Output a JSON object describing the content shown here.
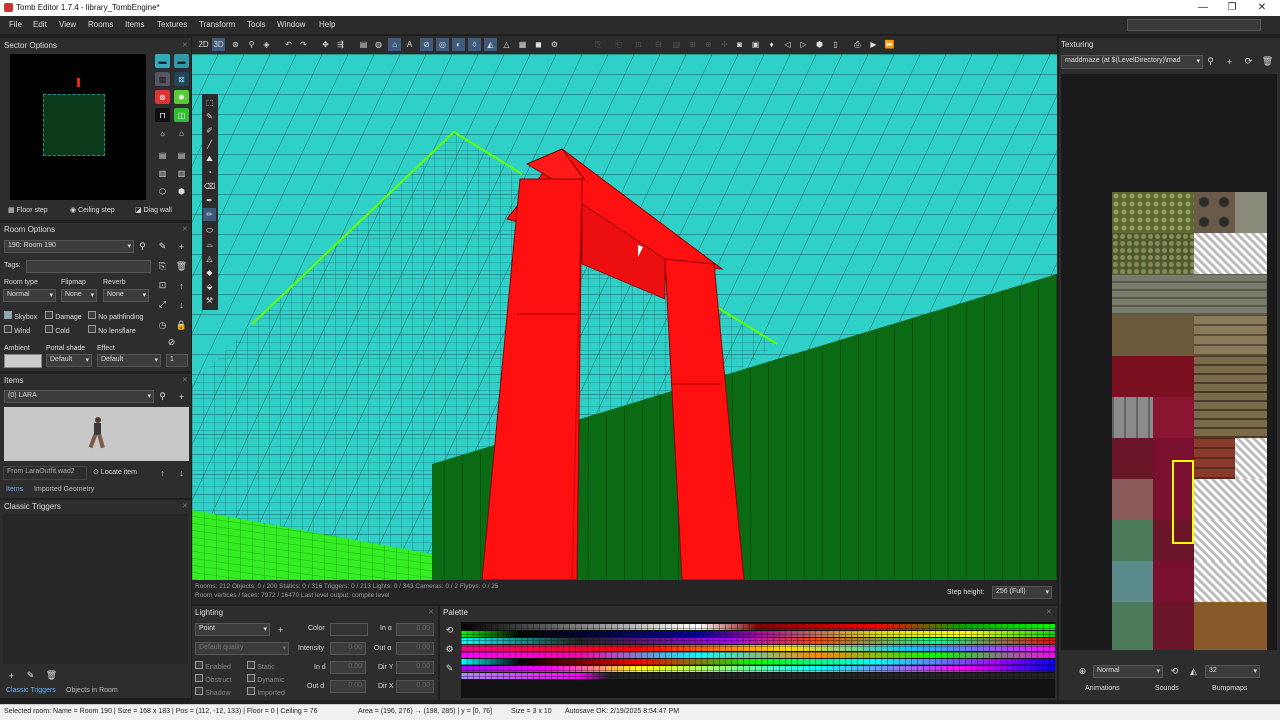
{
  "window": {
    "title": "Tomb Editor 1.7.4 - library_TombEngine*",
    "minimize": "—",
    "restore": "❐",
    "close": "✕"
  },
  "menu": [
    "File",
    "Edit",
    "View",
    "Rooms",
    "Items",
    "Textures",
    "Transform",
    "Tools",
    "Window",
    "Help"
  ],
  "toolbar": {
    "mode_2d": "2D",
    "mode_3d": "3D"
  },
  "sector_options": {
    "title": "Sector Options",
    "floor_step": "Floor step",
    "ceiling_step": "Ceiling step",
    "diag_wall": "Diag wall"
  },
  "room_options": {
    "title": "Room Options",
    "room_select": "190: Room 190",
    "tags_label": "Tags:",
    "room_type_label": "Room type",
    "room_type": "Normal",
    "flipmap_label": "Flipmap",
    "flipmap": "None",
    "reverb_label": "Reverb",
    "reverb": "None",
    "skybox": "Skybox",
    "damage": "Damage",
    "no_pathfinding": "No pathfinding",
    "wind": "Wind",
    "cold": "Cold",
    "no_lensflare": "No lensflare",
    "ambient_label": "Ambient",
    "portal_shade_label": "Portal shade",
    "portal_shade": "Default",
    "effect_label": "Effect",
    "effect": "Default",
    "effect_strength": "1"
  },
  "items": {
    "title": "Items",
    "selected": "(0) LARA",
    "source": "From LaraOutfit.wad2",
    "locate": "Locate item",
    "tab_items": "Items",
    "tab_imported": "Imported Geometry"
  },
  "triggers": {
    "title": "Classic Triggers",
    "tab_classic": "Classic Triggers",
    "tab_objects": "Objects in Room"
  },
  "viewport_info": {
    "line1": "Rooms: 212  Objects: 0 / 200  Statics: 0 / 316  Triggers: 0 / 213  Lights: 0 / 343  Cameras: 0 / 2  Flybys: 0 / 25",
    "line2": "Room vertices / faces: 7972 / 16470  Last level output: compile level",
    "step_label": "Step height:",
    "step_value": "256 (Full)"
  },
  "lighting": {
    "title": "Lighting",
    "type": "Point",
    "quality": "Default quality",
    "color_label": "Color",
    "intensity_label": "Intensity",
    "in_d_label": "In d",
    "out_d_label": "Out d",
    "in_a_label": "In α",
    "out_a_label": "Out α",
    "dir_y_label": "Dir Y",
    "dir_x_label": "Dir X",
    "zero": "0.00",
    "enabled": "Enabled",
    "obstruct": "Obstruct",
    "shadow": "Shadow",
    "static": "Static",
    "dynamic": "Dynamic",
    "imported": "Imported"
  },
  "palette": {
    "title": "Palette"
  },
  "texturing": {
    "title": "Texturing",
    "wad": "maddmaze (at $(LevelDirectory)\\mad",
    "blend": "Normal",
    "size": "32",
    "animations": "Animations",
    "sounds": "Sounds",
    "bumpmaps": "Bumpmaps"
  },
  "statusbar": {
    "selected": "Selected room: Name = Room 190 | Size = 168 x 183 | Pos = (112, -12, 133) | Floor = 0 | Ceiling = 76",
    "area": "Area = (196, 276) → (198, 285) | y = [0, 76]",
    "size": "Size = 3 x 10",
    "autosave": "Autosave OK: 2/19/2025 8:54:47 PM"
  },
  "colors": {
    "sky": "#2ed0c8",
    "pillar": "#ff1010",
    "wall": "#0a6b14",
    "floor": "#33ee22"
  }
}
